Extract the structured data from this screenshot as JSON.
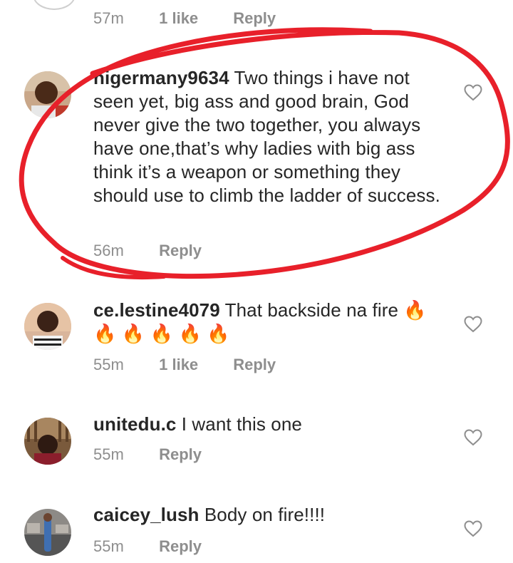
{
  "top_comment": {
    "time": "57m",
    "likes": "1 like",
    "reply": "Reply"
  },
  "comments": [
    {
      "username": "nigermany9634",
      "text": "Two things i have not seen yet, big ass and good brain, God never give the two together, you always have one,that’s why ladies with big ass think it’s a weapon or something they should use to climb the ladder of success.",
      "time": "56m",
      "likes": "",
      "reply": "Reply"
    },
    {
      "username": "ce.lestine4079",
      "text": "That backside na fire",
      "time": "55m",
      "likes": "1 like",
      "reply": "Reply"
    },
    {
      "username": "unitedu.c",
      "text": "I want this one",
      "time": "55m",
      "likes": "",
      "reply": "Reply"
    },
    {
      "username": "caicey_lush",
      "text": "Body on fire!!!!",
      "time": "55m",
      "likes": "",
      "reply": "Reply"
    }
  ],
  "icons": {
    "fire": "🔥",
    "heart": "heart-outline-icon"
  },
  "colors": {
    "annotation": "#e8202a",
    "meta": "#8e8e8e",
    "text": "#262626"
  }
}
